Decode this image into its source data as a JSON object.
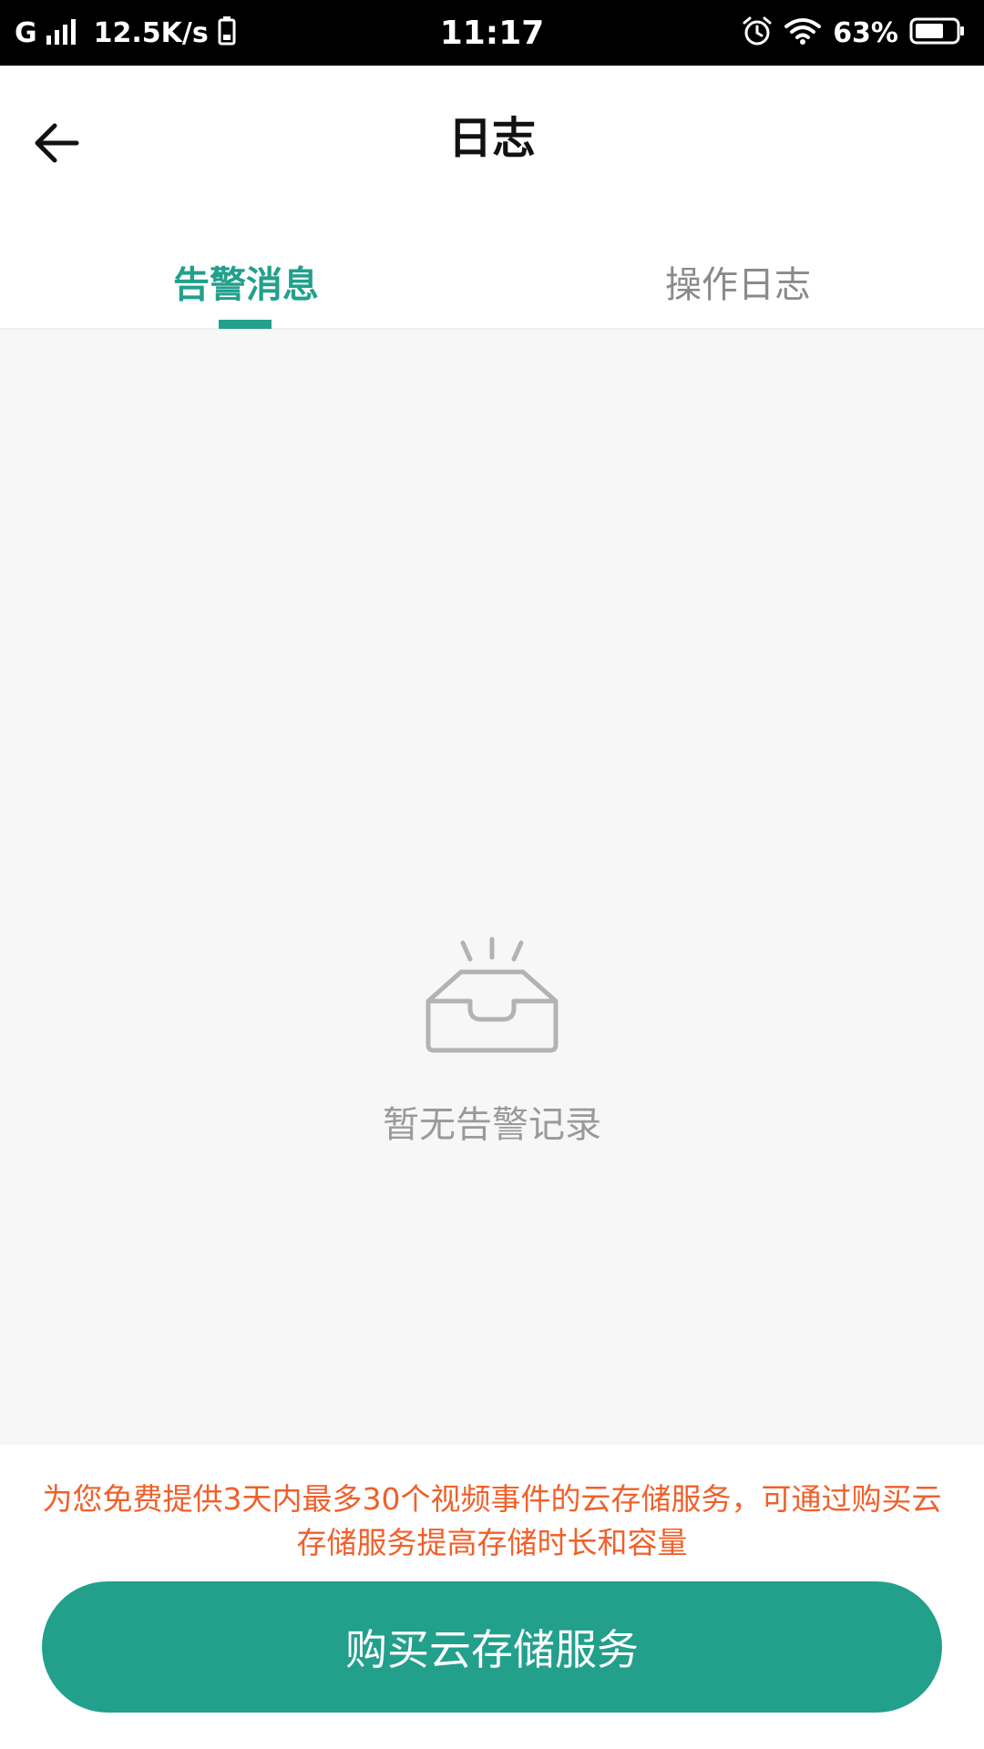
{
  "status_bar": {
    "network": "G",
    "speed": "12.5K/s",
    "time": "11:17",
    "battery_percent": "63%"
  },
  "header": {
    "title": "日志",
    "back_icon": "back-arrow-icon"
  },
  "tabs": [
    {
      "label": "告警消息",
      "active": true
    },
    {
      "label": "操作日志",
      "active": false
    }
  ],
  "empty_state": {
    "icon": "empty-inbox-icon",
    "text": "暂无告警记录"
  },
  "footer": {
    "notice": "为您免费提供3天内最多30个视频事件的云存储服务，可通过购买云存储服务提高存储时长和容量",
    "button_label": "购买云存储服务"
  },
  "colors": {
    "accent": "#22A08C",
    "notice": "#F0602A",
    "muted_text": "#9a9a9a",
    "background": "#f7f7f7"
  }
}
